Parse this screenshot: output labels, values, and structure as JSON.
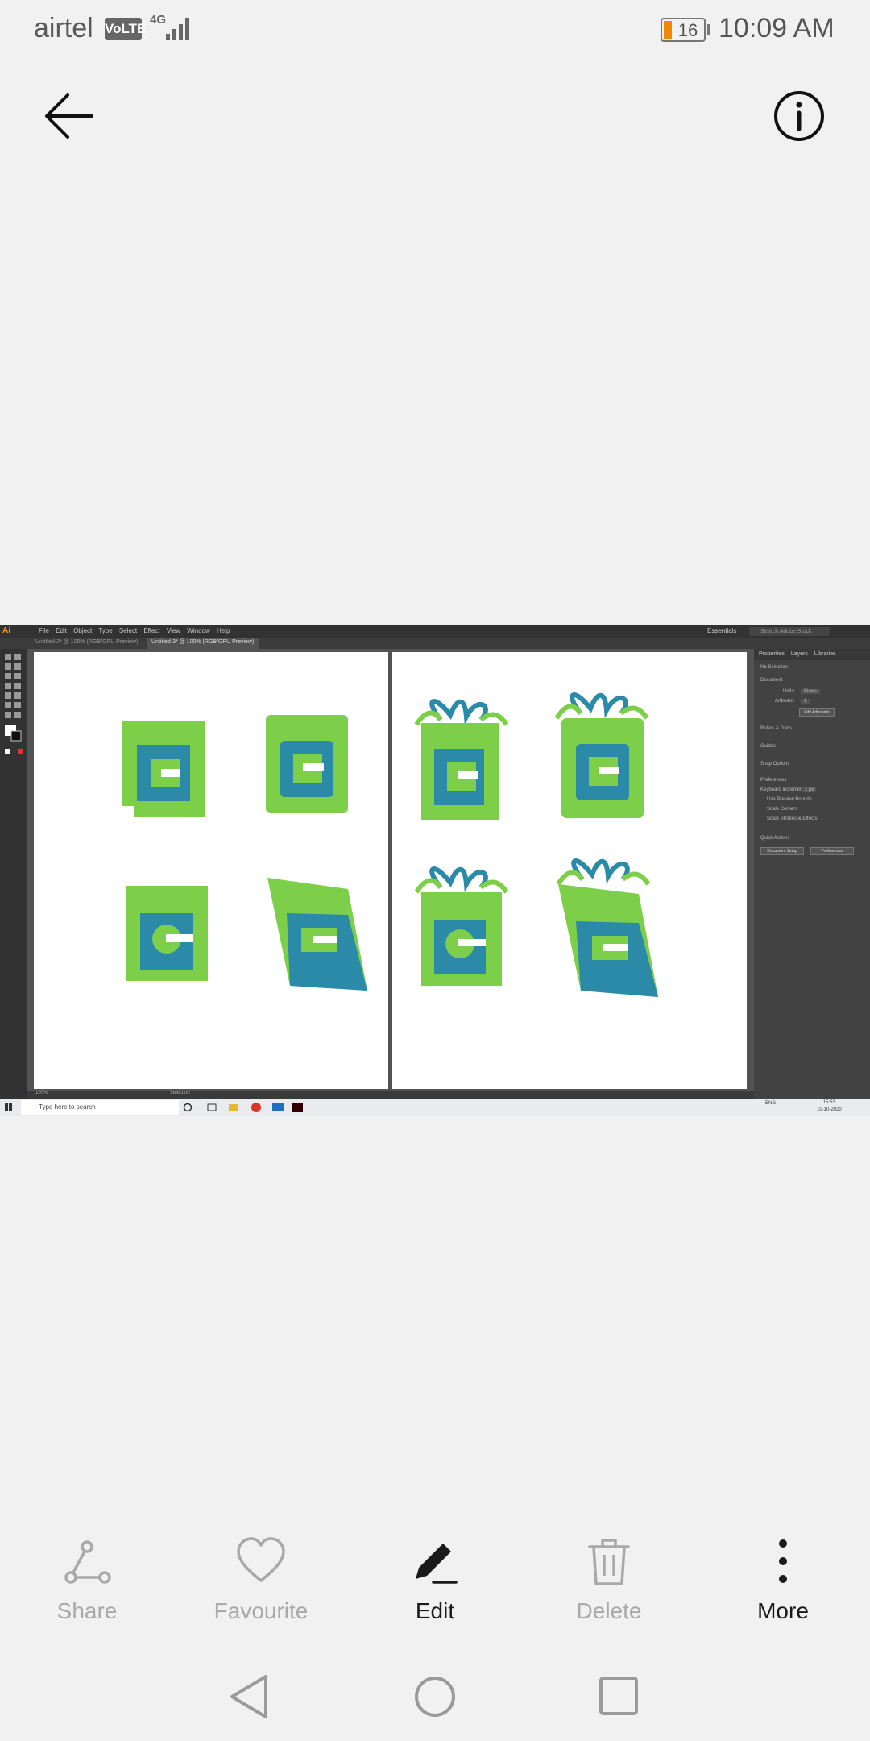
{
  "status": {
    "carrier": "airtel",
    "volte": "VoLTE",
    "network": "4G",
    "battery": "16",
    "time": "10:09 AM"
  },
  "illustrator": {
    "logo": "Ai",
    "menu": "File Edit Object Type Select Effect View Window Help",
    "workspace": "Essentials",
    "search": "Search Adobe Stock",
    "tab1": "Untitled-2* @ 100% (RGB/GPU Preview)",
    "tab2": "Untitled-3* @ 100% (RGB/GPU Preview)",
    "panel_tabs": "Properties Layers Libraries",
    "panel": {
      "no_selection": "No Selection",
      "document": "Document",
      "units_label": "Units:",
      "units_value": "Pixels",
      "artboard_label": "Artboard:",
      "artboard_value": "1",
      "edit_artboards": "Edit Artboards",
      "rulers": "Rulers & Grids",
      "guides": "Guides",
      "snap": "Snap Options",
      "preferences": "Preferences",
      "keyboard": "Keyboard Increment:",
      "keyboard_value": "1 px",
      "opt1": "Use Preview Bounds",
      "opt2": "Scale Corners",
      "opt3": "Scale Strokes & Effects",
      "quick": "Quick Actions",
      "doc_setup": "Document Setup",
      "prefs_btn": "Preferences"
    },
    "statusbar": "100%",
    "statusbar_tool": "Selection",
    "taskbar_search": "Type here to search",
    "tray": "ENG",
    "tray_time": "15:53",
    "tray_date": "10-10-2020"
  },
  "actions": [
    {
      "label": "Share",
      "icon": "share-icon"
    },
    {
      "label": "Favourite",
      "icon": "heart-icon"
    },
    {
      "label": "Edit",
      "icon": "pencil-icon"
    },
    {
      "label": "Delete",
      "icon": "trash-icon"
    },
    {
      "label": "More",
      "icon": "more-vertical-icon"
    }
  ],
  "colors": {
    "logo_green": "#7dcf4a",
    "logo_teal": "#2a8aa8",
    "active": "#1a1a1a",
    "inactive": "#a9a9a9"
  }
}
